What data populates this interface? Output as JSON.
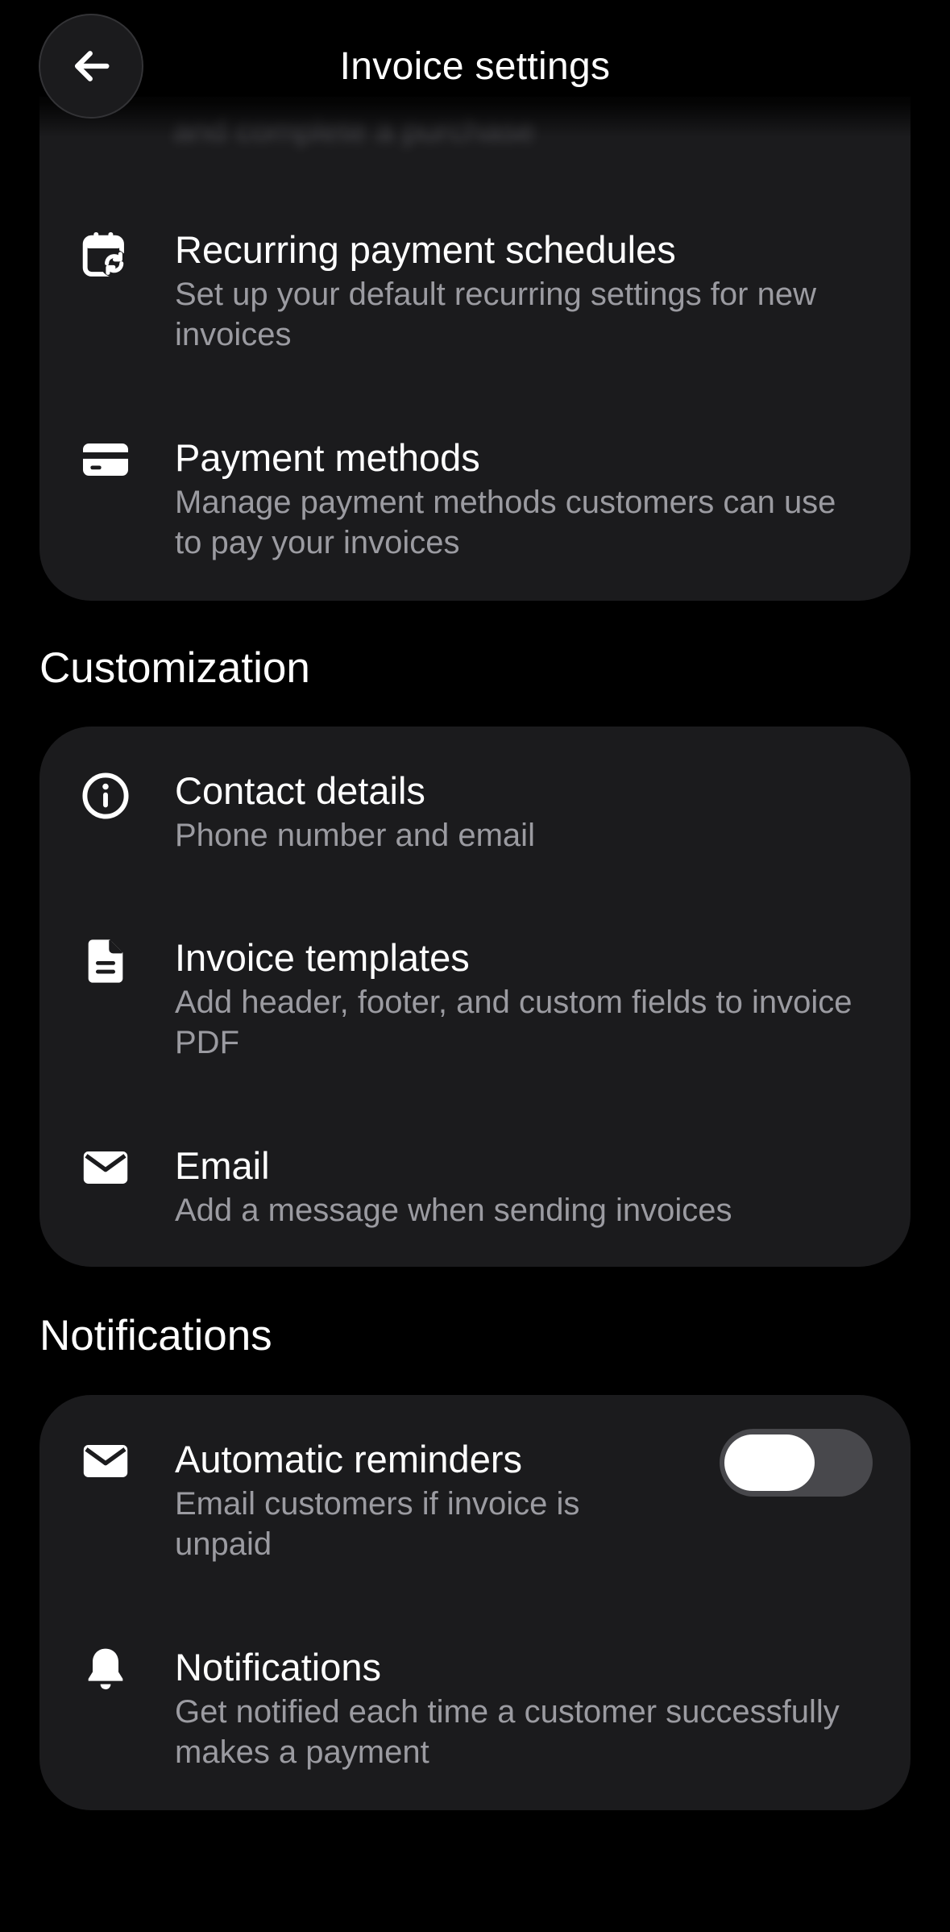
{
  "header": {
    "title": "Invoice settings",
    "back_icon": "arrow-left-icon",
    "scrolled_under_text": "and complete a purchase"
  },
  "payments_card": {
    "items": [
      {
        "icon": "calendar-repeat-icon",
        "title": "Recurring payment schedules",
        "subtitle": "Set up your default recurring settings for new invoices"
      },
      {
        "icon": "credit-card-icon",
        "title": "Payment methods",
        "subtitle": "Manage payment methods customers can use to pay your invoices"
      }
    ]
  },
  "customization": {
    "heading": "Customization",
    "items": [
      {
        "icon": "info-circle-icon",
        "title": "Contact details",
        "subtitle": "Phone number and email"
      },
      {
        "icon": "document-icon",
        "title": "Invoice templates",
        "subtitle": "Add header, footer, and custom fields to invoice PDF"
      },
      {
        "icon": "envelope-icon",
        "title": "Email",
        "subtitle": "Add a message when sending invoices"
      }
    ]
  },
  "notifications": {
    "heading": "Notifications",
    "items": [
      {
        "icon": "envelope-icon",
        "title": "Automatic reminders",
        "subtitle": "Email customers if invoice is unpaid",
        "toggle_on": false
      },
      {
        "icon": "bell-icon",
        "title": "Notifications",
        "subtitle": "Get notified each time a customer successfully makes a payment"
      }
    ]
  },
  "colors": {
    "background": "#000000",
    "card": "#1b1b1d",
    "secondary_text": "#9b9ba1",
    "toggle_track": "#48484c"
  }
}
